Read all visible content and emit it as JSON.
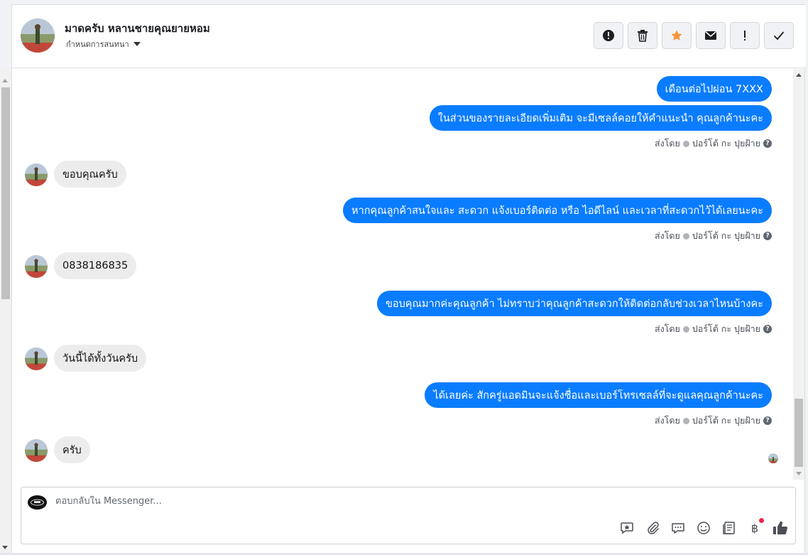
{
  "header": {
    "contact_name": "มาดครับ หลานชายคุณยายหอม",
    "subtitle": "กำหนดการสนทนา"
  },
  "header_actions": [
    {
      "name": "report-button",
      "icon": "exclamation-circle-icon"
    },
    {
      "name": "delete-button",
      "icon": "trash-icon"
    },
    {
      "name": "star-button",
      "icon": "star-icon",
      "color": "#f7923a"
    },
    {
      "name": "mark-unread-button",
      "icon": "envelope-icon"
    },
    {
      "name": "important-button",
      "icon": "exclamation-icon"
    },
    {
      "name": "done-button",
      "icon": "check-icon"
    }
  ],
  "messages": [
    {
      "dir": "out",
      "text": "เดือนต่อไปผ่อน 7XXX"
    },
    {
      "dir": "out",
      "text": "ในส่วนของรายละเอียดเพิ่มเติม จะมีเซลล์คอยให้คำแนะนำ คุณลูกค้านะคะ"
    },
    {
      "dir": "meta",
      "label": "ส่งโดย",
      "sender": "ปอร์โต้ กะ ปุยฝ้าย"
    },
    {
      "dir": "in",
      "text": "ขอบคุณครับ"
    },
    {
      "dir": "out",
      "text": "หากคุณลูกค้าสนใจและ สะดวก แจ้งเบอร์ติดต่อ หรือ ไอดีไลน์ และเวลาที่สะดวกไว้ได้เลยนะคะ"
    },
    {
      "dir": "meta",
      "label": "ส่งโดย",
      "sender": "ปอร์โต้ กะ ปุยฝ้าย"
    },
    {
      "dir": "in",
      "text": "0838186835"
    },
    {
      "dir": "out",
      "text": "ขอบคุณมากค่ะคุณลูกค้า ไม่ทราบว่าคุณลูกค้าสะดวกให้ติดต่อกลับช่วงเวลาไหนบ้างคะ"
    },
    {
      "dir": "meta",
      "label": "ส่งโดย",
      "sender": "ปอร์โต้ กะ ปุยฝ้าย"
    },
    {
      "dir": "in",
      "text": "วันนี้ได้ทั้งวันครับ"
    },
    {
      "dir": "out",
      "text": "ได้เลยค่ะ สักครู่แอดมินจะแจ้งชื่อและเบอร์โทรเซลล์ที่จะดูแลคุณลูกค้านะคะ"
    },
    {
      "dir": "meta",
      "label": "ส่งโดย",
      "sender": "ปอร์โต้ กะ ปุยฝ้าย"
    },
    {
      "dir": "in",
      "text": "ครับ"
    }
  ],
  "composer": {
    "placeholder": "ตอบกลับใน Messenger..."
  },
  "composer_tools": [
    "saved-reply-icon",
    "attachment-icon",
    "chat-bubble-icon",
    "emoji-icon",
    "notes-icon",
    "baht-icon",
    "like-icon"
  ],
  "colors": {
    "outgoing_bubble": "#0a7cff",
    "incoming_bubble": "#ececec",
    "notification_dot": "#f02849"
  }
}
